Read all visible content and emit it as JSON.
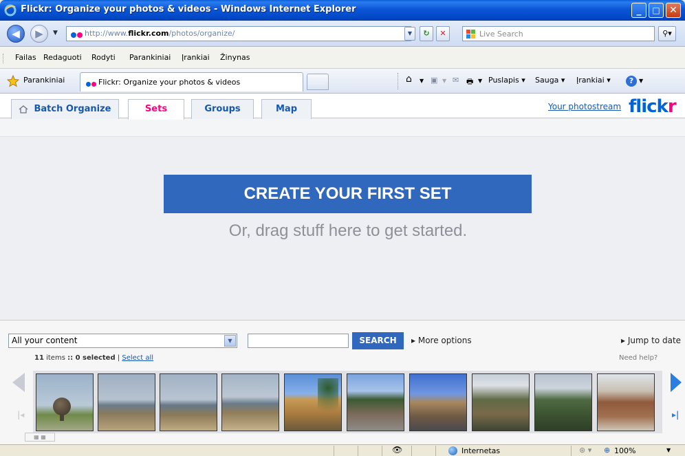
{
  "window": {
    "title": "Flickr: Organize your photos & videos - Windows Internet Explorer",
    "minimize": "_",
    "maximize": "□",
    "close": "✕"
  },
  "address": {
    "url_prefix": "http://www.",
    "url_domain": "flickr.com",
    "url_path": "/photos/organize/",
    "search_placeholder": "Live Search"
  },
  "menu": {
    "items": [
      "Failas",
      "Redaguoti",
      "Rodyti",
      "Parankiniai",
      "Įrankiai",
      "Žinynas"
    ]
  },
  "favorites": {
    "label": "Parankiniai",
    "tab_label": "Flickr: Organize your photos & videos",
    "commands": [
      "Puslapis ▾",
      "Sauga ▾",
      "Įrankiai ▾"
    ]
  },
  "flickr": {
    "tabs": [
      "Batch Organize",
      "Sets",
      "Groups",
      "Map"
    ],
    "active_tab": "Sets",
    "photostream": "Your photostream",
    "logo_flick": "flick",
    "logo_r": "r",
    "create_button": "CREATE YOUR FIRST SET",
    "drag_text": "Or, drag stuff here to get started."
  },
  "organizer": {
    "content_select": "All your content",
    "search_button": "SEARCH",
    "more_options": "More options",
    "jump_to_date": "Jump to date",
    "items_count": "11",
    "items_word": "items",
    "selected_text": ":: 0 selected",
    "select_all": "Select all",
    "need_help": "Need help?"
  },
  "status": {
    "zone": "Internetas",
    "zoom": "100%"
  },
  "colors": {
    "flickr_blue": "#0063dc",
    "flickr_pink": "#ff0084",
    "button_blue": "#3068be"
  }
}
